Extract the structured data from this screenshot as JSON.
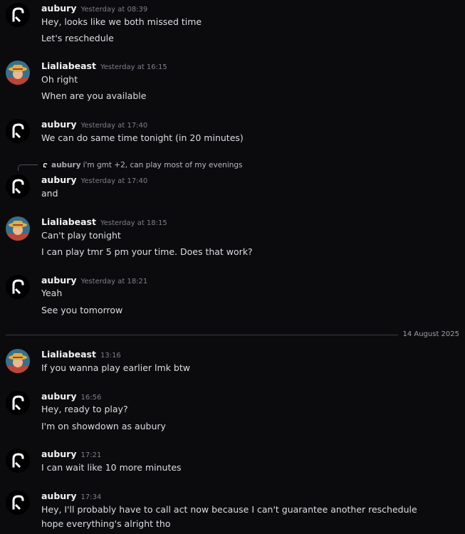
{
  "users": {
    "aubury": {
      "name": "aubury",
      "avatar_icon": "hook-glyph-avatar"
    },
    "lialia": {
      "name": "Lialiabeast",
      "avatar_icon": "straw-hat-character-avatar"
    }
  },
  "messages": [
    {
      "author": "aubury",
      "time": "Yesterday at 08:39",
      "lines": [
        "Hey, looks like we both missed time",
        "Let's reschedule"
      ]
    },
    {
      "author": "Lialiabeast",
      "time": "Yesterday at 16:15",
      "lines": [
        "Oh right",
        "When are you available"
      ]
    },
    {
      "author": "aubury",
      "time": "Yesterday at 17:40",
      "lines": [
        "We can do same time tonight (in 20 minutes)"
      ]
    },
    {
      "author": "aubury",
      "time": "Yesterday at 17:40",
      "reply": {
        "author": "aubury",
        "text": "i'm gmt +2, can play most of my evenings"
      },
      "lines": [
        "and"
      ]
    },
    {
      "author": "Lialiabeast",
      "time": "Yesterday at 18:15",
      "lines": [
        "Can't play tonight",
        "I can play tmr 5 pm your time. Does that work?"
      ]
    },
    {
      "author": "aubury",
      "time": "Yesterday at 18:21",
      "lines": [
        "Yeah",
        "See you tomorrow"
      ]
    },
    {
      "author": "Lialiabeast",
      "time": "13:16",
      "lines": [
        "If you wanna play earlier lmk btw"
      ]
    },
    {
      "author": "aubury",
      "time": "16:56",
      "lines": [
        "Hey, ready to play?",
        "I'm on showdown as aubury"
      ]
    },
    {
      "author": "aubury",
      "time": "17:21",
      "lines": [
        "I can wait like 10 more minutes"
      ]
    },
    {
      "author": "aubury",
      "time": "17:34",
      "lines": [
        "Hey, I'll probably have to call act now because I can't guarantee another reschedule",
        "hope everything's alright tho"
      ]
    }
  ],
  "date_divider": "14 August 2025",
  "colors": {
    "background": "#0b0b0d",
    "username": "#f2f3f5",
    "text": "#dbdee1",
    "timestamp": "#7d808a",
    "divider": "#3a3c42"
  }
}
